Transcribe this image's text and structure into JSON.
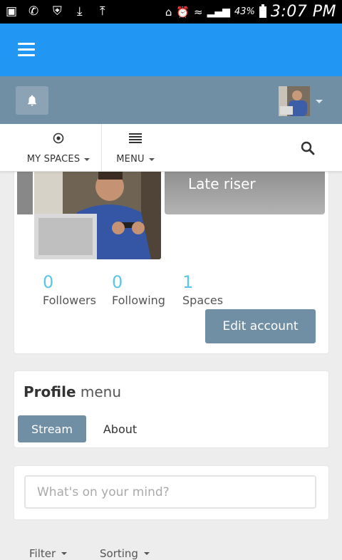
{
  "status_bar": {
    "battery": "43%",
    "time": "3:07 PM"
  },
  "nav": {
    "my_spaces_label": "MY SPACES",
    "menu_label": "MENU"
  },
  "profile": {
    "banner_title": "Late riser",
    "stats": [
      {
        "value": "0",
        "label": "Followers"
      },
      {
        "value": "0",
        "label": "Following"
      },
      {
        "value": "1",
        "label": "Spaces"
      }
    ],
    "edit_button_label": "Edit account"
  },
  "profile_menu": {
    "title_bold": "Profile",
    "title_rest": "menu",
    "tabs": [
      {
        "label": "Stream",
        "active": true
      },
      {
        "label": "About",
        "active": false
      }
    ]
  },
  "post": {
    "placeholder": "What's on your mind?"
  },
  "stream_controls": {
    "filter_label": "Filter",
    "sorting_label": "Sorting"
  },
  "colors": {
    "app_bar": "#2196f3",
    "sub_bar": "#708fa5",
    "accent_stat": "#5bc6e8",
    "button": "#708fa5"
  }
}
